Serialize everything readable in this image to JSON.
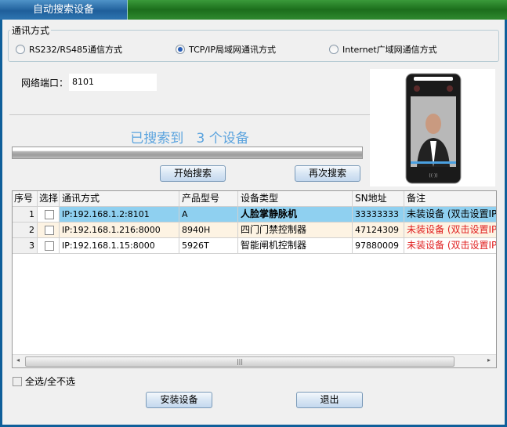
{
  "window": {
    "title": "自动搜索设备"
  },
  "comm": {
    "title": "通讯方式",
    "options": [
      {
        "label": "RS232/RS485通信方式",
        "selected": false
      },
      {
        "label": "TCP/IP局域网通讯方式",
        "selected": true
      },
      {
        "label": "Internet广域网通信方式",
        "selected": false
      }
    ]
  },
  "port": {
    "label": "网络端口：",
    "value": "8101"
  },
  "search": {
    "status": "已搜索到   3 个设备",
    "progress_percent": 100,
    "start_label": "开始搜索",
    "again_label": "再次搜索"
  },
  "table": {
    "columns": [
      "序号",
      "选择",
      "通讯方式",
      "产品型号",
      "设备类型",
      "SN地址",
      "备注"
    ],
    "rows": [
      {
        "no": "1",
        "checked": false,
        "comm": "IP:192.168.1.2:8101",
        "model": "A",
        "type": "人脸掌静脉机",
        "sn": "33333333",
        "note": "未装设备 (双击设置IP",
        "selected": true
      },
      {
        "no": "2",
        "checked": false,
        "comm": "IP:192.168.1.216:8000",
        "model": "8940H",
        "type": "四门门禁控制器",
        "sn": "47124309",
        "note": "未装设备 (双击设置IP",
        "selected": false
      },
      {
        "no": "3",
        "checked": false,
        "comm": "IP:192.168.1.15:8000",
        "model": "5926T",
        "type": "智能闸机控制器",
        "sn": "97880009",
        "note": "未装设备 (双击设置IP",
        "selected": false
      }
    ]
  },
  "select_all": {
    "label": "全选/全不选",
    "checked": false
  },
  "footer": {
    "install_label": "安装设备",
    "exit_label": "退出"
  },
  "colors": {
    "title_blue": "#1f5f9b",
    "title_green": "#1c6e1c",
    "status_blue": "#5aa3de",
    "selected_row": "#8fd0f0",
    "alt_row": "#fdf3e3",
    "note_red": "#e02020"
  }
}
